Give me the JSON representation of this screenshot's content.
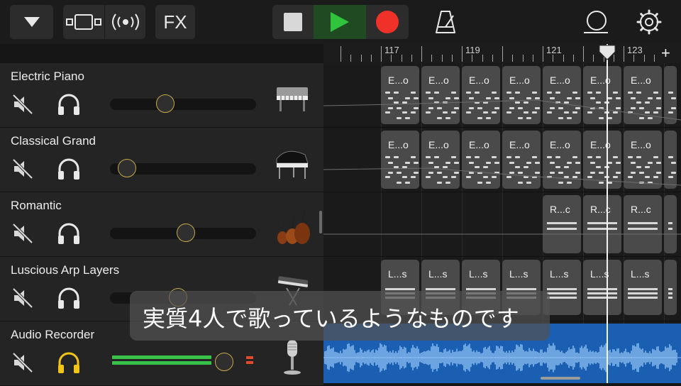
{
  "toolbar": {
    "fx_label": "FX",
    "icons": [
      "chevron-down-icon",
      "tracks-view-icon",
      "live-loops-icon",
      "stop-icon",
      "play-icon",
      "record-icon",
      "metronome-icon",
      "loop-icon",
      "settings-icon"
    ]
  },
  "ruler": {
    "bar_numbers": [
      "117",
      "119",
      "121",
      "123"
    ],
    "add_label": "+"
  },
  "tracks": [
    {
      "name": "Electric Piano",
      "volume": 0.36,
      "instrument_icon": "electric-piano-icon"
    },
    {
      "name": "Classical Grand",
      "volume": 0.06,
      "instrument_icon": "grand-piano-icon"
    },
    {
      "name": "Romantic",
      "volume": 0.52,
      "instrument_icon": "strings-icon"
    },
    {
      "name": "Luscious Arp Layers",
      "volume": 0.46,
      "instrument_icon": "synth-keyboard-icon"
    },
    {
      "name": "Audio Recorder",
      "volume": 0.82,
      "instrument_icon": "microphone-icon"
    }
  ],
  "regions": {
    "electric_piano": "E...o",
    "classical_grand": "E...o",
    "romantic": "R...c",
    "arp": "L...s"
  },
  "subtitle": "実質4人で歌っているようなものです",
  "colors": {
    "play": "#2fc43b",
    "record": "#f0312a",
    "knob_ring": "#c8a84a",
    "solo_active": "#f2c415",
    "audio_region": "#1a5fb1",
    "meter": "#39c24a"
  }
}
